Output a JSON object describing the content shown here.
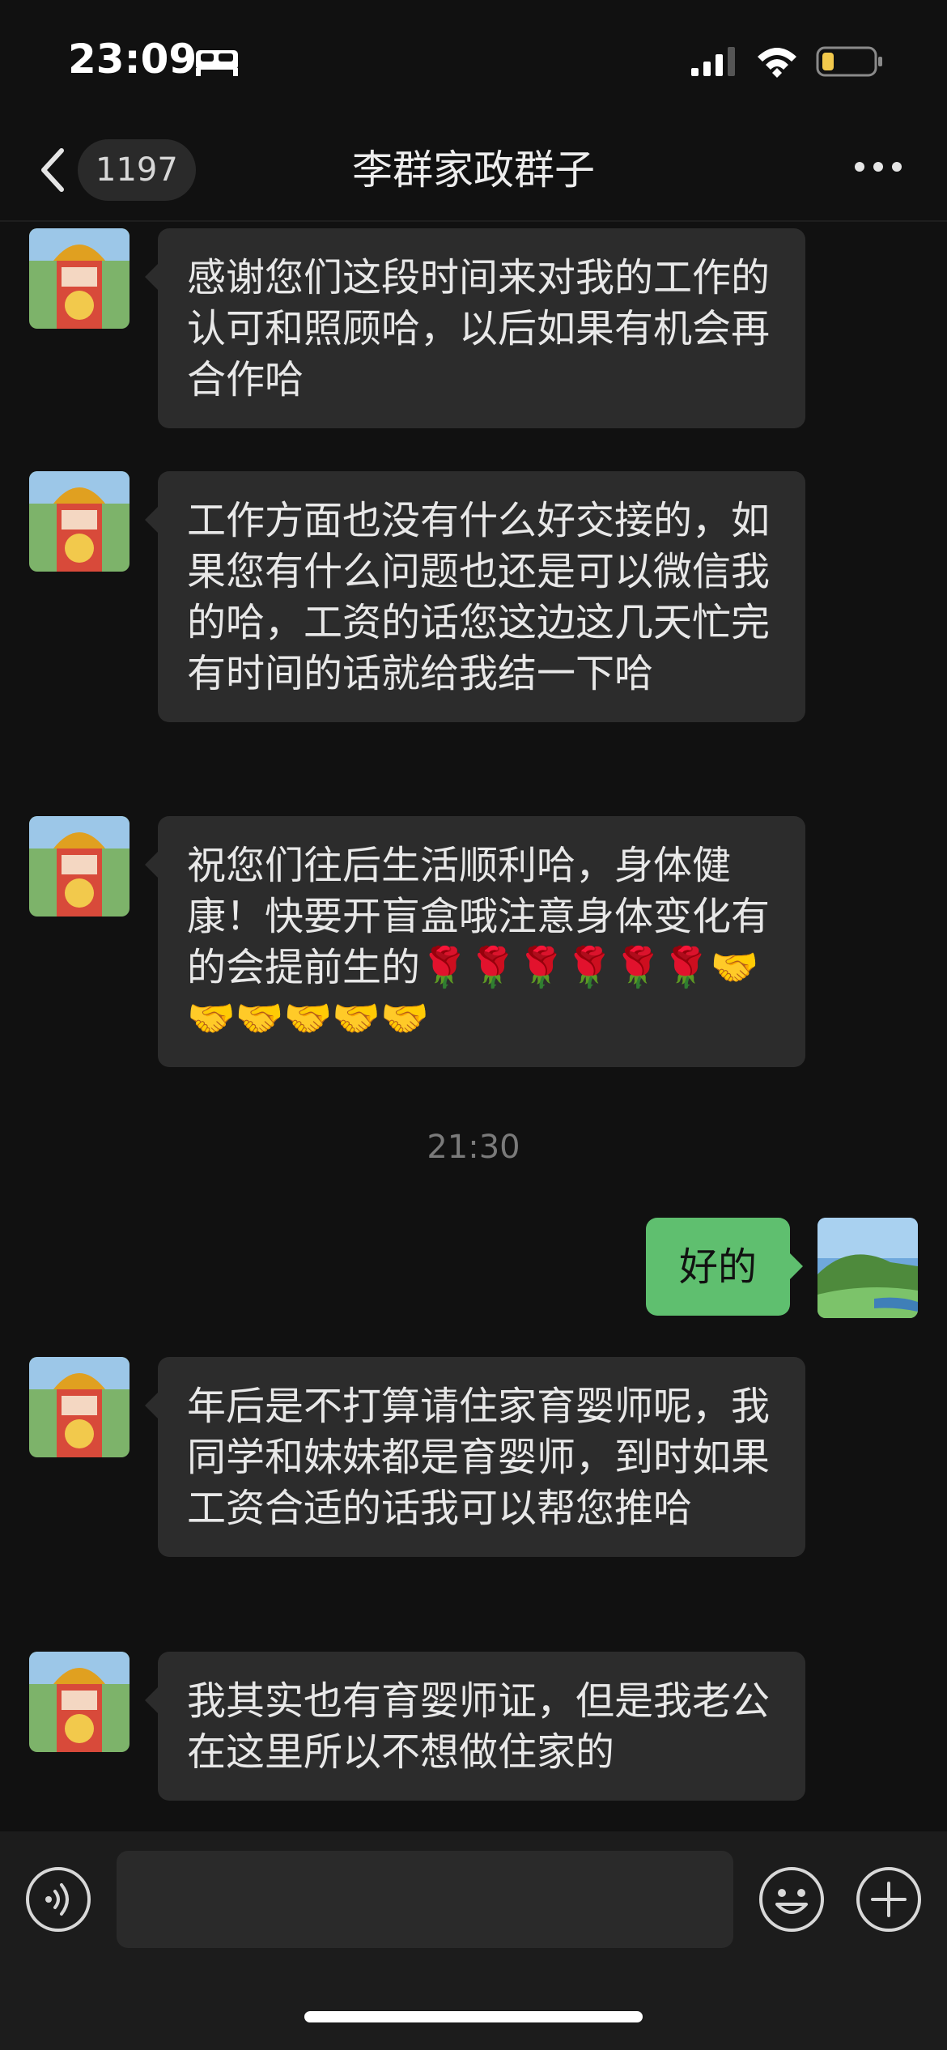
{
  "status_bar": {
    "time": "23:09"
  },
  "nav": {
    "unread_count": "1197",
    "title": "李群家政群子"
  },
  "messages": [
    {
      "sender": "contact",
      "text": "感谢您们这段时间来对我的工作的认可和照顾哈，以后如果有机会再合作哈"
    },
    {
      "sender": "contact",
      "text": "工作方面也没有什么好交接的，如果您有什么问题也还是可以微信我的哈，工资的话您这边这几天忙完有时间的话就给我结一下哈"
    },
    {
      "sender": "contact",
      "text": "祝您们往后生活顺利哈，身体健康！快要开盲盒哦注意身体变化有的会提前生的🌹🌹🌹🌹🌹🌹🤝🤝🤝🤝🤝🤝"
    },
    {
      "sender": "me",
      "text": "好的"
    },
    {
      "sender": "contact",
      "text": "年后是不打算请住家育婴师呢，我同学和妹妹都是育婴师，到时如果工资合适的话我可以帮您推哈"
    },
    {
      "sender": "contact",
      "text": "我其实也有育婴师证，但是我老公在这里所以不想做住家的"
    }
  ],
  "timestamp": "21:30",
  "input_bar": {
    "voice_icon": "voice-icon",
    "emoji_icon": "emoji-icon",
    "plus_icon": "plus-icon"
  },
  "colors": {
    "background": "#111111",
    "incoming_bubble": "#2C2C2C",
    "outgoing_bubble": "#5FBF6F"
  }
}
